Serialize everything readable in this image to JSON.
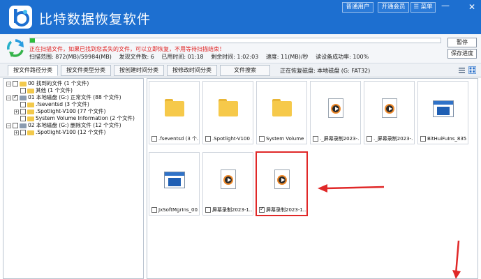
{
  "app": {
    "title": "比特数据恢复软件"
  },
  "titlebar": {
    "register_label": "普通用户",
    "member_label": "开通会员",
    "menu_label": "菜单",
    "minimize_label": "—",
    "close_label": "✕"
  },
  "status": {
    "progress_fraction": 0.012,
    "warning": "正在扫描文件，如果已找到您丢失的文件，可以立即恢复，不用等待扫描结束！",
    "scan_range": "扫描范围: 872(MB)/59984(MB)",
    "found_files": "发现文件数: 6",
    "elapsed": "已用时间: 01:18",
    "remaining": "剩余时间: 1:02:03",
    "speed": "速度: 11(MB)/秒",
    "read_failure": "读设备成功率: 100%",
    "pause_label": "暂停",
    "save_progress_label": "保存进度"
  },
  "tabs": [
    {
      "label": "按文件路径分类",
      "active": true
    },
    {
      "label": "按文件类型分类",
      "active": false
    },
    {
      "label": "按创建时间分类",
      "active": false
    },
    {
      "label": "按修改时间分类",
      "active": false
    },
    {
      "label": "文件搜索",
      "active": false
    }
  ],
  "current_drive": "正在恢复磁盘: 本地磁盘 (G: FAT32)",
  "tree": [
    {
      "label": "00 找到的文件  (1 个文件)",
      "level": 0,
      "expander": "−",
      "checked": false,
      "icon": "folder"
    },
    {
      "label": "其他  (1 个文件)",
      "level": 1,
      "expander": "",
      "checked": false,
      "icon": "folder"
    },
    {
      "label": "01 本地磁盘 (G:) 正常文件  (88 个文件)",
      "level": 0,
      "expander": "−",
      "checked": true,
      "icon": "drive"
    },
    {
      "label": ".fseventsd    (3 个文件)",
      "level": 1,
      "expander": "",
      "checked": false,
      "icon": "folder"
    },
    {
      "label": ".Spotlight-V100    (77 个文件)",
      "level": 1,
      "expander": "+",
      "checked": false,
      "icon": "folder"
    },
    {
      "label": "System Volume Information    (2 个文件)",
      "level": 1,
      "expander": "",
      "checked": false,
      "icon": "folder"
    },
    {
      "label": "02 本地磁盘 (G:) 删除文件  (12 个文件)",
      "level": 0,
      "expander": "−",
      "checked": false,
      "icon": "drive"
    },
    {
      "label": ".Spotlight-V100    (12 个文件)",
      "level": 1,
      "expander": "+",
      "checked": false,
      "icon": "folder"
    }
  ],
  "files": [
    {
      "name": ".fseventsd  (3 个...",
      "kind": "folder",
      "checked": false,
      "selected": false
    },
    {
      "name": ".Spotlight-V100 ...",
      "kind": "folder",
      "checked": false,
      "selected": false
    },
    {
      "name": "System Volume In...",
      "kind": "folder",
      "checked": false,
      "selected": false
    },
    {
      "name": "._屏幕录制2023-...",
      "kind": "video",
      "checked": false,
      "selected": false
    },
    {
      "name": "._屏幕录制2023-...",
      "kind": "video",
      "checked": false,
      "selected": false
    },
    {
      "name": "BitHuiFuIns_835....",
      "kind": "exe",
      "checked": false,
      "selected": false
    },
    {
      "name": "JxSoftMgrIns_00...",
      "kind": "exe",
      "checked": false,
      "selected": false
    },
    {
      "name": "屏幕录制2023-1...",
      "kind": "video",
      "checked": false,
      "selected": false
    },
    {
      "name": "屏幕录制2023-1...",
      "kind": "video",
      "checked": true,
      "selected": true
    }
  ],
  "colors": {
    "titlebar": "#1d6fd0",
    "progress": "#2dbd3a",
    "warning": "#e02020",
    "annotation": "#e02828"
  },
  "icons": {
    "logo": "bit-logo-icon",
    "refresh": "refresh-icon",
    "list_view": "list-view-icon",
    "grid_view": "grid-view-icon"
  }
}
